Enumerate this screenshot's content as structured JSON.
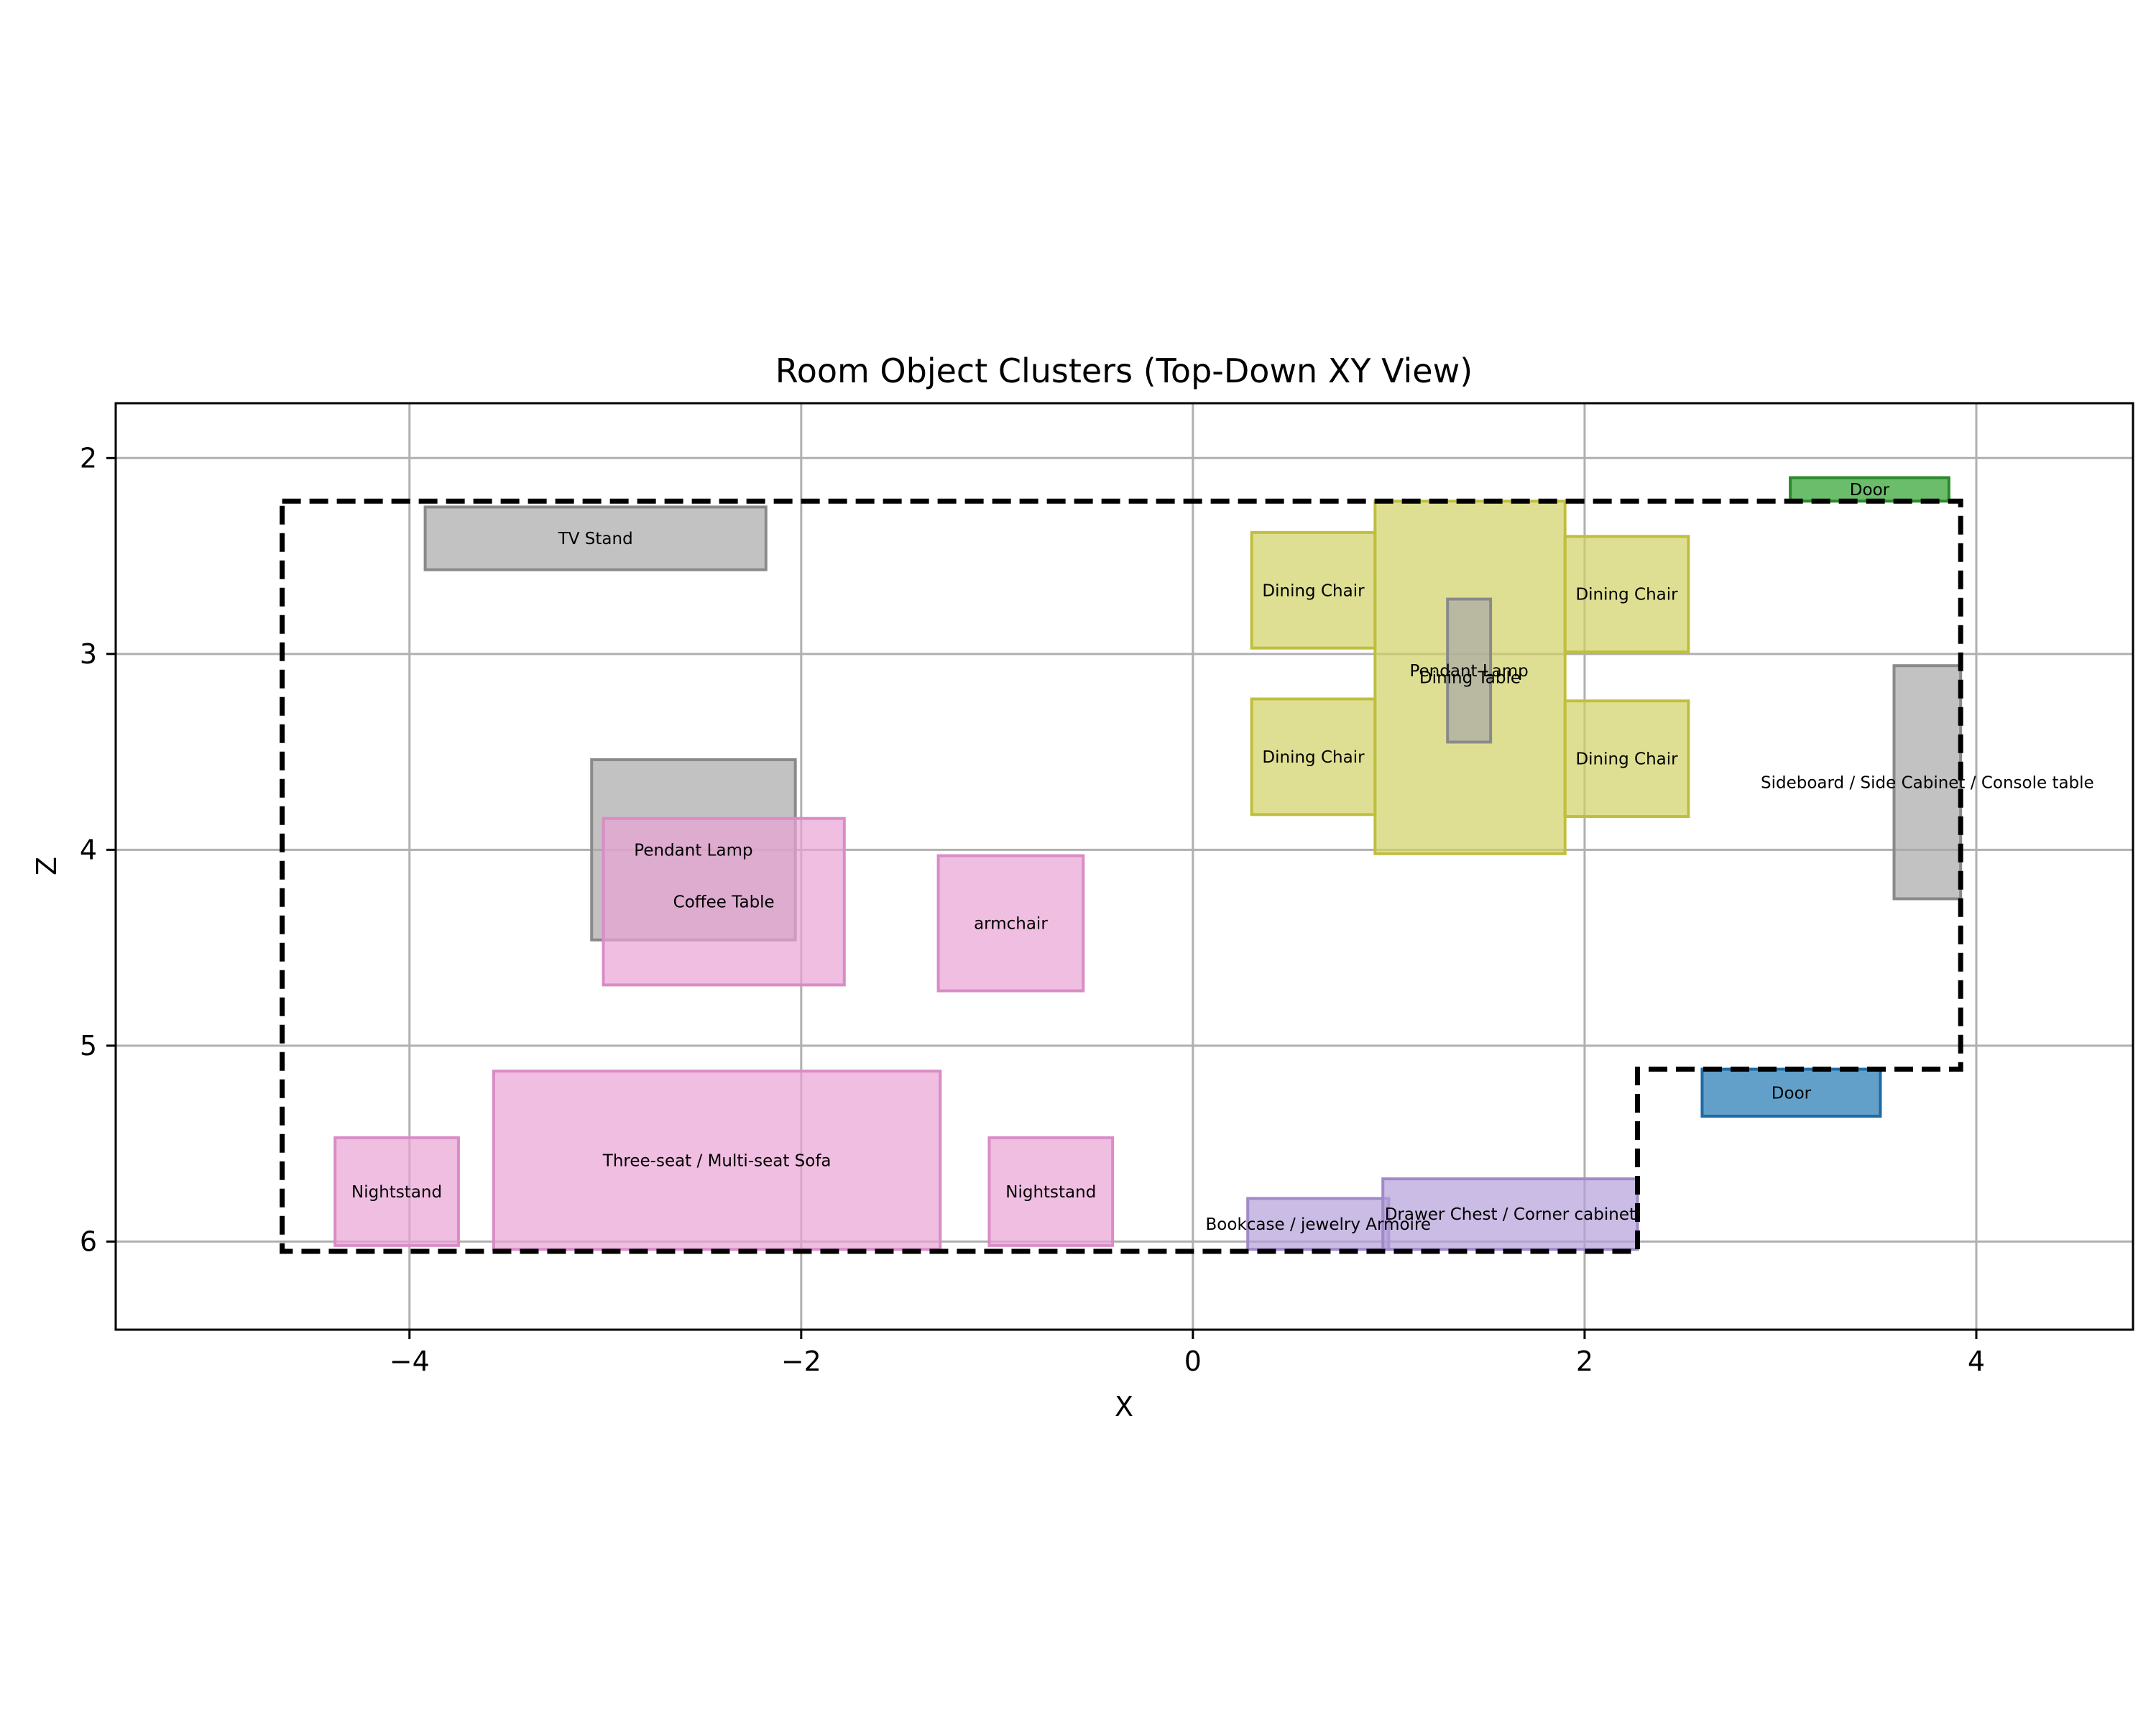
{
  "chart_data": {
    "type": "floor-plan",
    "title": "Room Object Clusters (Top-Down XY View)",
    "xlabel": "X",
    "ylabel": "Z",
    "xlim": [
      -5.5,
      4.8
    ],
    "ylim": [
      1.72,
      6.45
    ],
    "y_inverted": true,
    "grid": true,
    "x_ticks": [
      -4,
      -2,
      0,
      2,
      4
    ],
    "x_tick_labels": [
      "−4",
      "−2",
      "0",
      "2",
      "4"
    ],
    "y_ticks": [
      2,
      3,
      4,
      5,
      6
    ],
    "y_tick_labels": [
      "2",
      "3",
      "4",
      "5",
      "6"
    ],
    "room_boundary": [
      [
        -4.65,
        2.22
      ],
      [
        3.92,
        2.22
      ],
      [
        3.92,
        5.12
      ],
      [
        2.27,
        5.12
      ],
      [
        2.27,
        6.05
      ],
      [
        -4.65,
        6.05
      ],
      [
        -4.65,
        2.22
      ]
    ],
    "objects": [
      {
        "label": "TV Stand",
        "x0": -3.92,
        "x1": -2.18,
        "z0": 2.25,
        "z1": 2.57,
        "color": "#a8a8a8",
        "edge": "#8a8a8a"
      },
      {
        "label": "Pendant Lamp",
        "x0": -3.07,
        "x1": -2.03,
        "z0": 3.54,
        "z1": 4.46,
        "color": "#a8a8a8",
        "edge": "#8a8a8a"
      },
      {
        "label": "Coffee Table",
        "x0": -3.01,
        "x1": -1.78,
        "z0": 3.84,
        "z1": 4.69,
        "color": "#e8a2d4",
        "edge": "#d98cc6"
      },
      {
        "label": "armchair",
        "x0": -1.3,
        "x1": -0.56,
        "z0": 4.03,
        "z1": 4.72,
        "color": "#e8a2d4",
        "edge": "#d98cc6"
      },
      {
        "label": "Nightstand",
        "x0": -4.38,
        "x1": -3.75,
        "z0": 5.47,
        "z1": 6.02,
        "color": "#e8a2d4",
        "edge": "#d98cc6"
      },
      {
        "label": "Three-seat / Multi-seat Sofa",
        "x0": -3.57,
        "x1": -1.29,
        "z0": 5.13,
        "z1": 6.04,
        "color": "#e8a2d4",
        "edge": "#d98cc6"
      },
      {
        "label": "Nightstand",
        "x0": -1.04,
        "x1": -0.41,
        "z0": 5.47,
        "z1": 6.02,
        "color": "#e8a2d4",
        "edge": "#d98cc6"
      },
      {
        "label": "Dining Table",
        "x0": 0.93,
        "x1": 1.9,
        "z0": 2.22,
        "z1": 4.02,
        "color": "#d2d166",
        "edge": "#bfbf3e"
      },
      {
        "label": "Dining Chair",
        "x0": 0.3,
        "x1": 0.93,
        "z0": 2.38,
        "z1": 2.97,
        "color": "#d2d166",
        "edge": "#bfbf3e"
      },
      {
        "label": "Dining Chair",
        "x0": 1.9,
        "x1": 2.53,
        "z0": 2.4,
        "z1": 2.99,
        "color": "#d2d166",
        "edge": "#bfbf3e"
      },
      {
        "label": "Dining Chair",
        "x0": 0.3,
        "x1": 0.93,
        "z0": 3.23,
        "z1": 3.82,
        "color": "#d2d166",
        "edge": "#bfbf3e"
      },
      {
        "label": "Dining Chair",
        "x0": 1.9,
        "x1": 2.53,
        "z0": 3.24,
        "z1": 3.83,
        "color": "#d2d166",
        "edge": "#bfbf3e"
      },
      {
        "label": "Pendant Lamp",
        "x0": 1.3,
        "x1": 1.52,
        "z0": 2.72,
        "z1": 3.45,
        "color": "#a8a8a8",
        "edge": "#8a8a8a"
      },
      {
        "label": "Door",
        "x0": 3.05,
        "x1": 3.86,
        "z0": 2.1,
        "z1": 2.22,
        "color": "#2ca02c",
        "edge": "#2a8a2a"
      },
      {
        "label": "Sideboard / Side Cabinet / Console table",
        "x0": 3.58,
        "x1": 3.92,
        "z0": 3.06,
        "z1": 4.25,
        "color": "#a8a8a8",
        "edge": "#8a8a8a"
      },
      {
        "label": "Door",
        "x0": 2.6,
        "x1": 3.51,
        "z0": 5.12,
        "z1": 5.36,
        "color": "#1f77b4",
        "edge": "#1f6aa3"
      },
      {
        "label": "Bookcase / jewelry Armoire",
        "x0": 0.28,
        "x1": 1.0,
        "z0": 5.78,
        "z1": 6.04,
        "color": "#b49fd8",
        "edge": "#a08ac9"
      },
      {
        "label": "Drawer Chest / Corner cabinet",
        "x0": 0.97,
        "x1": 2.27,
        "z0": 5.68,
        "z1": 6.04,
        "color": "#b49fd8",
        "edge": "#a08ac9"
      }
    ]
  }
}
